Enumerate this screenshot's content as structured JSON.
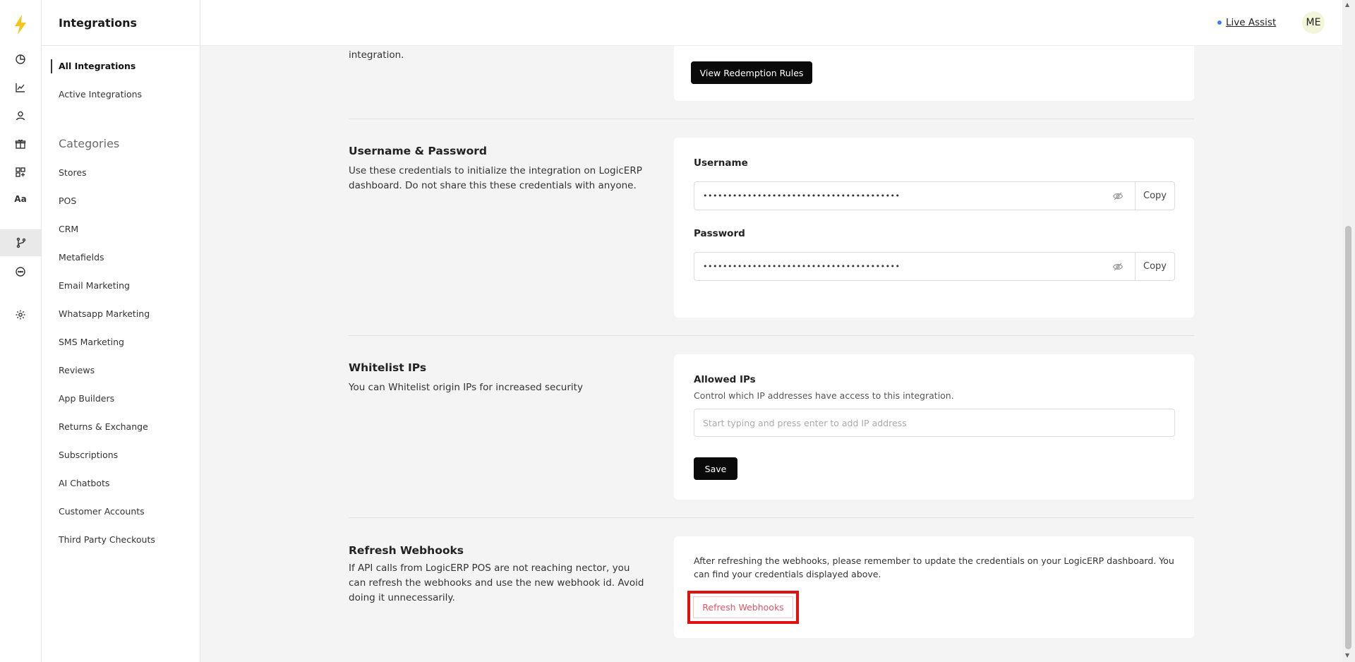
{
  "sidebar": {
    "title": "Integrations",
    "nav": [
      "All Integrations",
      "Active Integrations"
    ],
    "categories_title": "Categories",
    "categories": [
      "Stores",
      "POS",
      "CRM",
      "Metafields",
      "Email Marketing",
      "Whatsapp Marketing",
      "SMS Marketing",
      "Reviews",
      "App Builders",
      "Returns & Exchange",
      "Subscriptions",
      "AI Chatbots",
      "Customer Accounts",
      "Third Party Checkouts"
    ]
  },
  "rail": {
    "text_icon": "Aa"
  },
  "topbar": {
    "live_assist": "Live Assist",
    "avatar_initials": "ME"
  },
  "partial": {
    "left_text": "integration.",
    "button": "View Redemption Rules"
  },
  "credentials": {
    "title": "Username & Password",
    "desc": "Use these credentials to initialize the integration on LogicERP dashboard. Do not share this these credentials with anyone.",
    "username_label": "Username",
    "username_mask": "••••••••••••••••••••••••••••••••••••••••",
    "password_label": "Password",
    "password_mask": "••••••••••••••••••••••••••••••••••••••••",
    "copy": "Copy"
  },
  "whitelist": {
    "title": "Whitelist IPs",
    "desc": "You can Whitelist origin IPs for increased security",
    "label": "Allowed IPs",
    "sublabel": "Control which IP addresses have access to this integration.",
    "placeholder": "Start typing and press enter to add IP address",
    "save": "Save"
  },
  "webhooks": {
    "title": "Refresh Webhooks",
    "desc": "If API calls from LogicERP POS are not reaching nector, you can refresh the webhooks and use the new webhook id. Avoid doing it unnecessarily.",
    "note": "After refreshing the webhooks, please remember to update the credentials on your LogicERP dashboard. You can find your credentials displayed above.",
    "button": "Refresh Webhooks"
  }
}
